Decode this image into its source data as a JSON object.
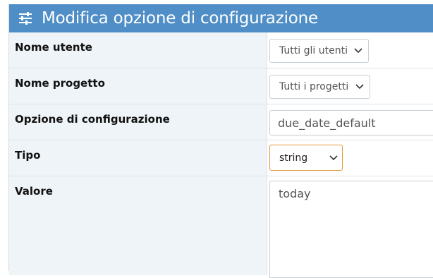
{
  "header": {
    "title": "Modifica opzione di configurazione",
    "icon": "sliders-icon"
  },
  "form": {
    "user": {
      "label": "Nome utente",
      "value": "Tutti gli utenti"
    },
    "project": {
      "label": "Nome progetto",
      "value": "Tutti i progetti"
    },
    "option": {
      "label": "Opzione di configurazione",
      "value": "due_date_default"
    },
    "type": {
      "label": "Tipo",
      "value": "string"
    },
    "value": {
      "label": "Valore",
      "value": "today"
    }
  },
  "colors": {
    "header_bg": "#4f8ec6",
    "label_bg": "#eef4f8",
    "focus_border": "#e09a3a"
  }
}
